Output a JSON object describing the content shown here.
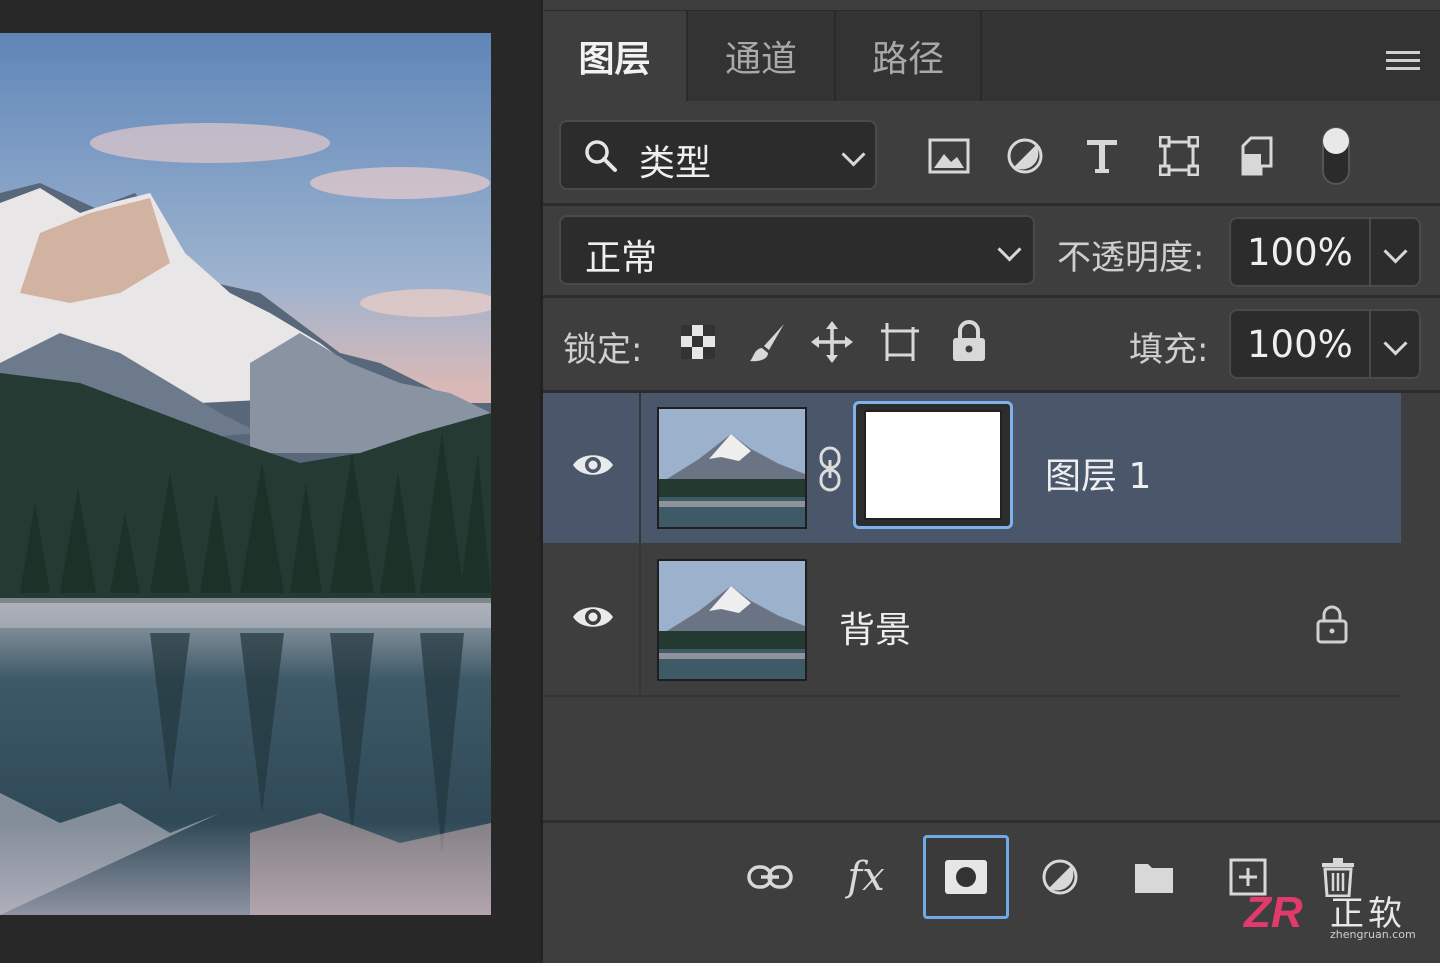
{
  "panel": {
    "tabs": [
      {
        "label": "图层",
        "active": true
      },
      {
        "label": "通道",
        "active": false
      },
      {
        "label": "路径",
        "active": false
      }
    ],
    "menu_icon": "hamburger-menu-icon"
  },
  "filter": {
    "kind_value": "类型",
    "filter_icons": [
      "image-filter-icon",
      "adjustment-filter-icon",
      "type-filter-icon",
      "shape-filter-icon",
      "smart-object-filter-icon",
      "filter-toggle-switch"
    ]
  },
  "blend": {
    "mode": "正常",
    "opacity_label": "不透明度:",
    "opacity_value": "100%"
  },
  "lock": {
    "label": "锁定:",
    "icons": [
      "lock-transparent-pixels-icon",
      "lock-image-pixels-icon",
      "lock-position-icon",
      "lock-artboard-icon",
      "lock-all-icon"
    ],
    "fill_label": "填充:",
    "fill_value": "100%"
  },
  "layers": [
    {
      "name": "图层 1",
      "selected": true,
      "visible": true,
      "has_mask": true
    },
    {
      "name": "背景",
      "selected": false,
      "visible": true,
      "locked": true
    }
  ],
  "bottom_toolbar": {
    "buttons": [
      "link-layers-icon",
      "fx-icon",
      "add-mask-icon",
      "adjustment-layer-icon",
      "new-group-icon",
      "new-layer-icon",
      "delete-icon"
    ],
    "fx_label": "fx",
    "active": "add-mask-icon"
  },
  "watermark": {
    "logo": "ZR",
    "name": "正软",
    "url": "zhengruan.com"
  },
  "colors": {
    "panel_bg": "#3e3e3e",
    "selected_layer_bg": "#4a5669",
    "accent_blue": "#6fa9e6"
  }
}
